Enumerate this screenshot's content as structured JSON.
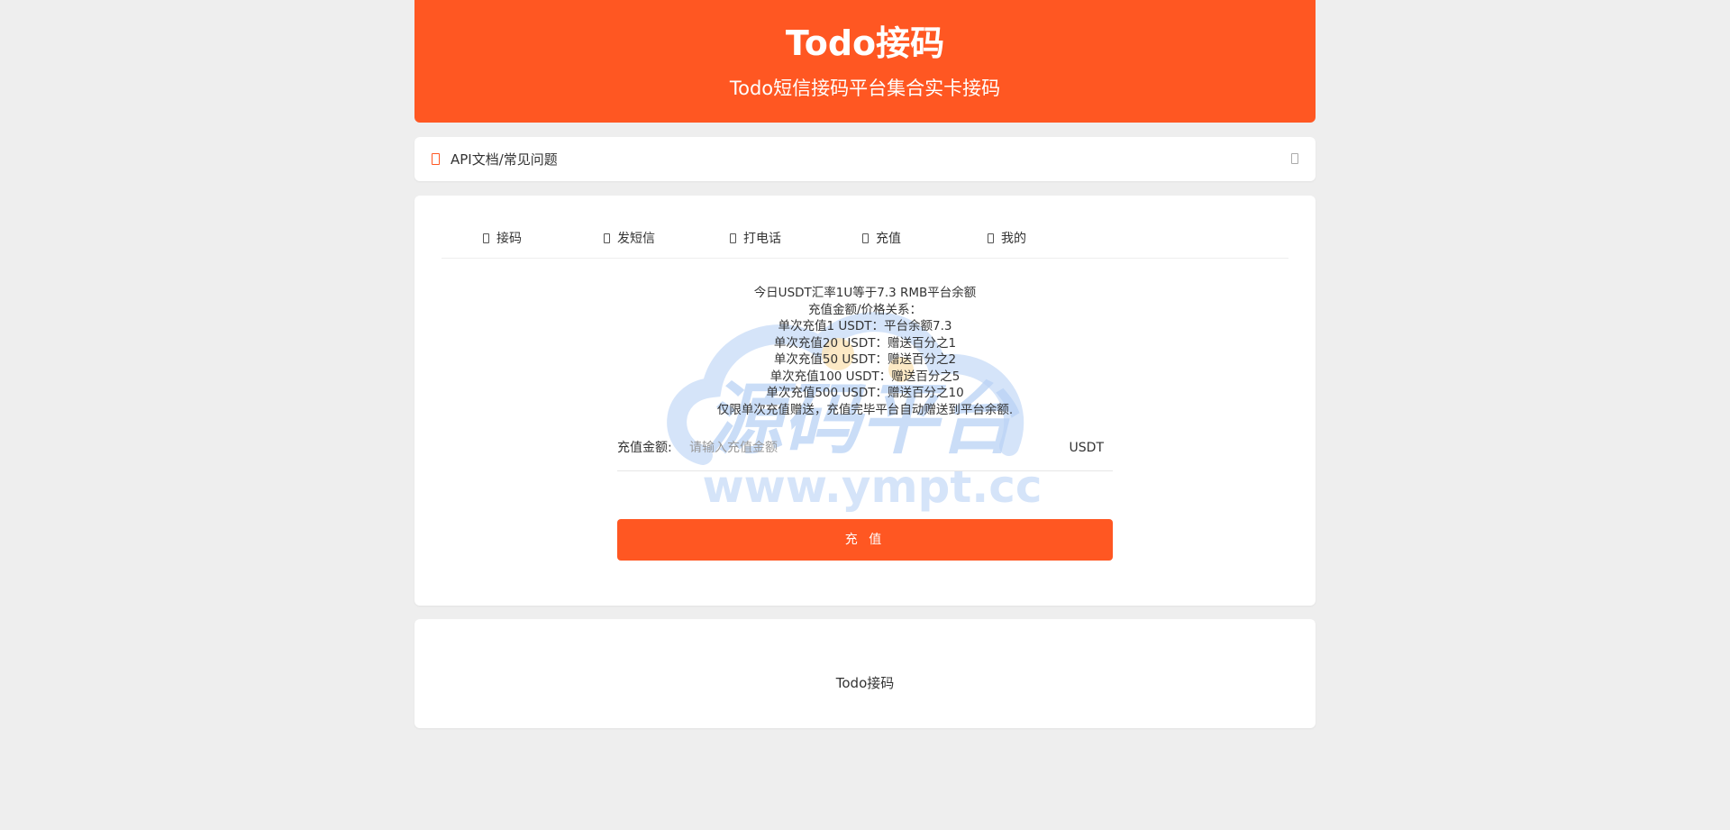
{
  "header": {
    "title": "Todo接码",
    "subtitle": "Todo短信接码平台集合实卡接码"
  },
  "notice": {
    "label": "API文档/常见问题",
    "icon": "bell-icon",
    "chevron_icon": "chevron-right-icon"
  },
  "tabs": [
    {
      "label": "接码",
      "icon": "sms-icon"
    },
    {
      "label": "发短信",
      "icon": "send-icon"
    },
    {
      "label": "打电话",
      "icon": "phone-icon"
    },
    {
      "label": "充值",
      "icon": "recharge-icon"
    },
    {
      "label": "我的",
      "icon": "user-icon"
    }
  ],
  "info": {
    "lines": [
      "今日USDT汇率1U等于7.3 RMB平台余额",
      "充值金额/价格关系：",
      "单次充值1 USDT：平台余额7.3",
      "单次充值20 USDT：赠送百分之1",
      "单次充值50 USDT：赠送百分之2",
      "单次充值100 USDT：赠送百分之5",
      "单次充值500 USDT：赠送百分之10",
      "仅限单次充值赠送，充值完毕平台自动赠送到平台余额."
    ]
  },
  "form": {
    "amount_label": "充值金额:",
    "amount_placeholder": "请输入充值金额",
    "amount_value": "",
    "unit": "USDT"
  },
  "submit_label": "充 值",
  "watermark": {
    "brand": "源码平台",
    "url": "www.ympt.cc"
  },
  "footer": {
    "text": "Todo接码"
  },
  "colors": {
    "accent": "#ff5722",
    "background": "#eeeeee",
    "card": "#ffffff"
  }
}
